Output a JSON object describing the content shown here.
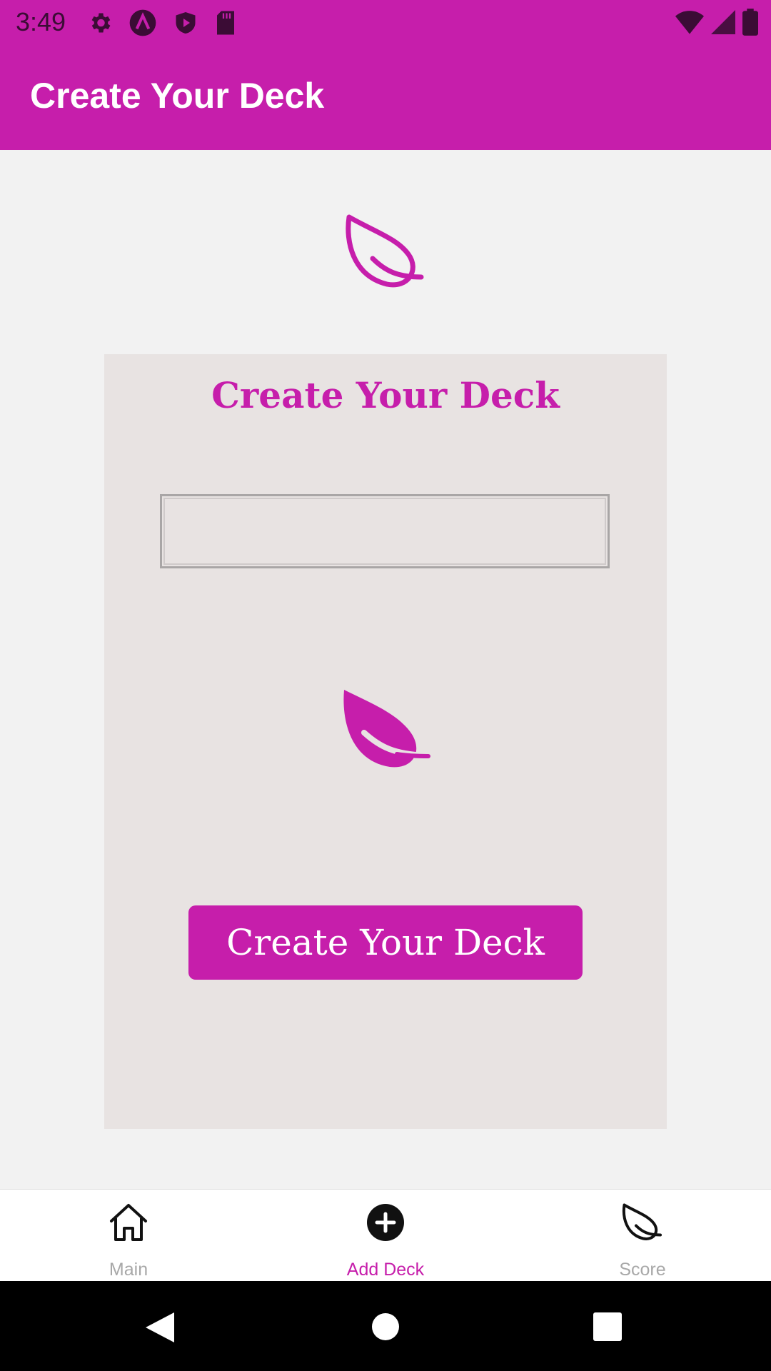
{
  "status_bar": {
    "time": "3:49",
    "left_icons": [
      "settings-icon",
      "arch-icon",
      "shield-play-icon",
      "sd-card-icon"
    ],
    "right_icons": [
      "wifi-icon",
      "cell-signal-icon",
      "battery-icon"
    ]
  },
  "app_bar": {
    "title": "Create Your Deck"
  },
  "card": {
    "title": "Create Your Deck",
    "input": {
      "value": "",
      "placeholder": ""
    },
    "button_label": "Create Your Deck"
  },
  "bottom_nav": {
    "items": [
      {
        "label": "Main",
        "icon": "home-icon",
        "active": false
      },
      {
        "label": "Add Deck",
        "icon": "plus-circle-icon",
        "active": true
      },
      {
        "label": "Score",
        "icon": "leaf-icon",
        "active": false
      }
    ]
  },
  "colors": {
    "accent": "#c61eab",
    "card_bg": "#e8e3e2",
    "page_bg": "#f2f2f2",
    "inactive_nav": "#a8a8a8"
  }
}
